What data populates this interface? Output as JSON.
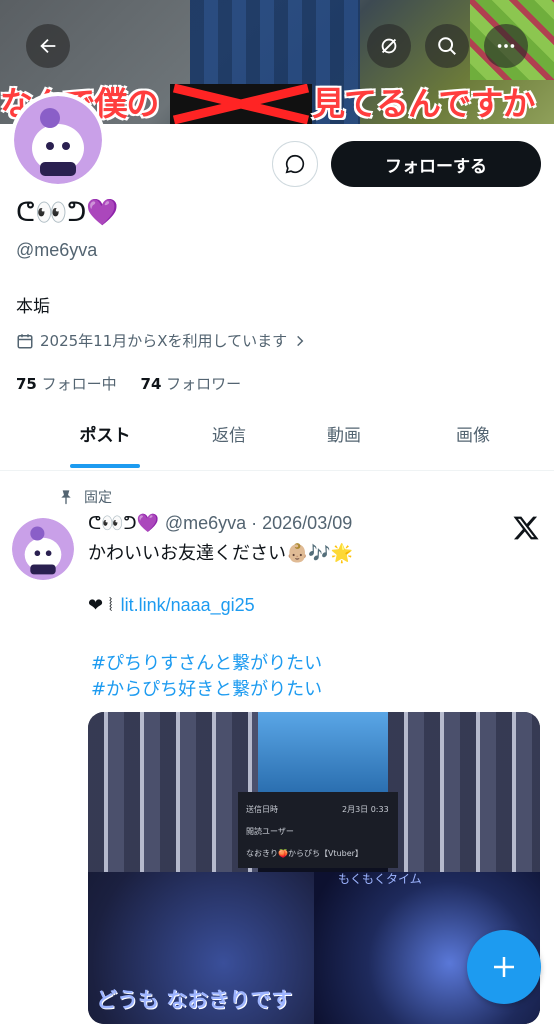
{
  "banner": {
    "caption_left": "なんで僕の",
    "caption_right": "見てるんですか"
  },
  "profile": {
    "name": "ᕦ👀ᕤ💜",
    "handle": "@me6yva",
    "bio": "本垢",
    "joined": "2025年11月からXを利用しています",
    "following_count": "75",
    "following_label": "フォロー中",
    "followers_count": "74",
    "followers_label": "フォロワー",
    "follow_label": "フォローする"
  },
  "tabs": [
    {
      "label": "ポスト"
    },
    {
      "label": "返信"
    },
    {
      "label": "動画"
    },
    {
      "label": "画像"
    }
  ],
  "post": {
    "pinned_label": "固定",
    "author_name": "ᕦ👀ᕤ💜",
    "meta": "@me6yva · 2026/03/09",
    "text": "かわいいお友達ください👶🏼🎶🌟",
    "link_prefix": "❤︎ ⦚",
    "link": "lit.link/naaa_gi25",
    "hashtag1": "#ぴちりすさんと繋がりたい",
    "hashtag2": "#からぴち好きと繋がりたい",
    "media_caption": "どうも なおきりです",
    "media_text1": "送信日時",
    "media_text2": "2月3日 0:33",
    "media_text3": "閲読ユーザー",
    "media_text4": "なおきり🍑からぴち【Vtuber】",
    "media_text5": "もくもくタイム"
  },
  "colors": {
    "accent": "#1d9bf0",
    "text": "#0f1419",
    "secondary": "#536471"
  },
  "icons": [
    "back-arrow-icon",
    "hide-reposts-icon",
    "search-icon",
    "more-icon",
    "message-icon",
    "calendar-icon",
    "chevron-right-icon",
    "pin-icon",
    "x-logo-icon",
    "compose-plus-icon"
  ]
}
